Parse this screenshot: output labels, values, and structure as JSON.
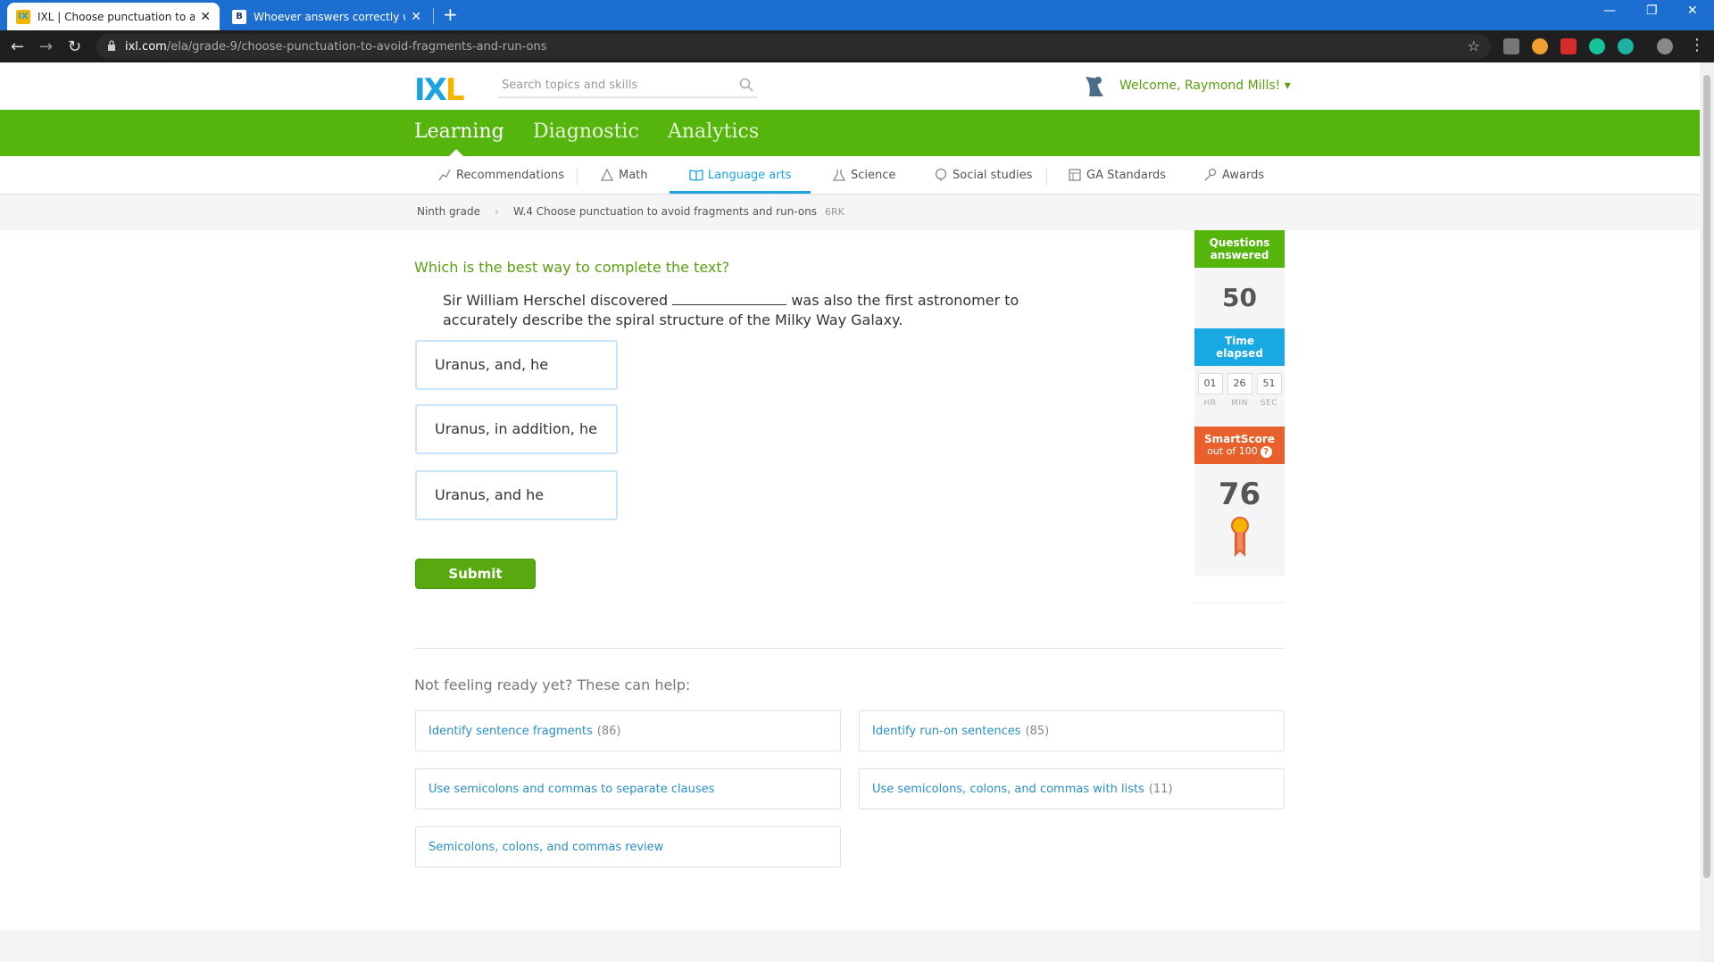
{
  "browser": {
    "tabs": [
      {
        "title": "IXL | Choose punctuation to avoid fragments and run-ons",
        "active": true
      },
      {
        "title": "Whoever answers correctly will get",
        "active": false
      }
    ],
    "url_host": "ixl.com",
    "url_path": "/ela/grade-9/choose-punctuation-to-avoid-fragments-and-run-ons",
    "accent": "#1c6fd1"
  },
  "header": {
    "logo": {
      "i": "I",
      "x": "X",
      "l": "L"
    },
    "search_placeholder": "Search topics and skills",
    "welcome": "Welcome, Raymond Mills! ▾"
  },
  "main_nav": {
    "items": [
      {
        "label": "Learning",
        "active": true
      },
      {
        "label": "Diagnostic",
        "active": false
      },
      {
        "label": "Analytics",
        "active": false
      }
    ],
    "bg_color": "#56b50d"
  },
  "sub_nav": {
    "items": [
      {
        "label": "Recommendations",
        "icon": "recommendations-icon"
      },
      {
        "label": "Math",
        "icon": "math-icon"
      },
      {
        "label": "Language arts",
        "icon": "book-icon",
        "active": true
      },
      {
        "label": "Science",
        "icon": "science-icon"
      },
      {
        "label": "Social studies",
        "icon": "globe-icon"
      },
      {
        "label": "GA Standards",
        "icon": "standards-icon"
      },
      {
        "label": "Awards",
        "icon": "awards-icon"
      }
    ]
  },
  "breadcrumb": {
    "grade": "Ninth grade",
    "separator": "›",
    "skill": "W.4 Choose punctuation to avoid fragments and run-ons",
    "code": "6RK"
  },
  "question": {
    "prompt": "Which is the best way to complete the text?",
    "text_before": "Sir William Herschel discovered",
    "text_after": "was also the first astronomer to accurately describe the spiral structure of the Milky Way Galaxy.",
    "choices": [
      "Uranus, and, he",
      "Uranus, in addition, he",
      "Uranus, and he"
    ],
    "submit_label": "Submit"
  },
  "sidebar": {
    "questions_label_1": "Questions",
    "questions_label_2": "answered",
    "questions_value": "50",
    "time_label_1": "Time",
    "time_label_2": "elapsed",
    "time": [
      {
        "value": "01",
        "unit": "HR"
      },
      {
        "value": "26",
        "unit": "MIN"
      },
      {
        "value": "51",
        "unit": "SEC"
      }
    ],
    "smartscore_label": "SmartScore",
    "smartscore_sub": "out of 100",
    "smartscore_value": "76"
  },
  "help": {
    "title": "Not feeling ready yet? These can help:",
    "links": [
      {
        "label": "Identify sentence fragments",
        "count": "(86)"
      },
      {
        "label": "Identify run-on sentences",
        "count": "(85)"
      },
      {
        "label": "Use semicolons and commas to separate clauses",
        "count": ""
      },
      {
        "label": "Use semicolons, colons, and commas with lists",
        "count": "(11)"
      },
      {
        "label": "Semicolons, colons, and commas review",
        "count": ""
      }
    ]
  }
}
